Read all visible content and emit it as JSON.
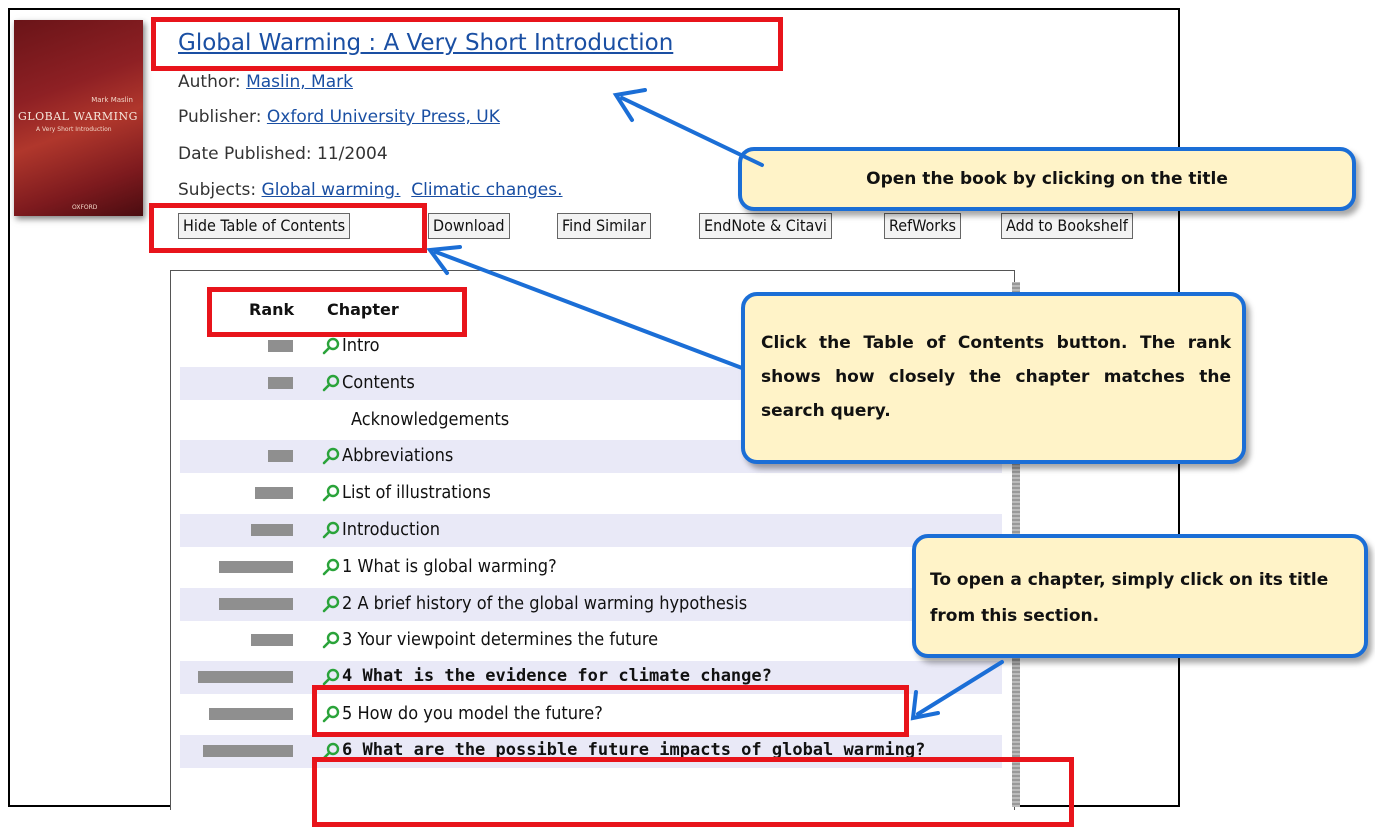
{
  "book": {
    "title": "Global Warming : A Very Short Introduction",
    "author_label": "Author:",
    "author": "Maslin, Mark",
    "publisher_label": "Publisher:",
    "publisher": "Oxford University Press, UK",
    "date_label": "Date Published:",
    "date": "11/2004",
    "subjects_label": "Subjects:",
    "subjects": [
      "Global warming.",
      "Climatic changes."
    ],
    "cover": {
      "title": "GLOBAL WARMING",
      "subtitle": "A Very Short Introduction",
      "author": "Mark Maslin",
      "publisher": "OXFORD"
    }
  },
  "buttons": [
    "Hide Table of Contents",
    "Download",
    "Find Similar",
    "EndNote & Citavi",
    "RefWorks",
    "Add to Bookshelf"
  ],
  "toc": {
    "rank_header": "Rank",
    "chapter_header": "Chapter",
    "rows": [
      {
        "label": "Intro",
        "rank": 0.26,
        "search_icon": true,
        "bold": false
      },
      {
        "label": "Contents",
        "rank": 0.26,
        "search_icon": true,
        "bold": false
      },
      {
        "label": "Acknowledgements",
        "rank": 0,
        "search_icon": false,
        "bold": false
      },
      {
        "label": "Abbreviations",
        "rank": 0.26,
        "search_icon": true,
        "bold": false
      },
      {
        "label": "List of illustrations",
        "rank": 0.4,
        "search_icon": true,
        "bold": false
      },
      {
        "label": "Introduction",
        "rank": 0.44,
        "search_icon": true,
        "bold": false
      },
      {
        "label": "1 What is global warming?",
        "rank": 0.78,
        "search_icon": true,
        "bold": false
      },
      {
        "label": "2 A brief history of the global warming hypothesis",
        "rank": 0.78,
        "search_icon": true,
        "bold": false
      },
      {
        "label": "3 Your viewpoint determines the future",
        "rank": 0.44,
        "search_icon": true,
        "bold": false
      },
      {
        "label": "4 What is the evidence for climate change?",
        "rank": 1.0,
        "search_icon": true,
        "bold": true
      },
      {
        "label": "5 How do you model the future?",
        "rank": 0.88,
        "search_icon": true,
        "bold": false
      },
      {
        "label": "6 What are the possible future impacts of global warming?",
        "rank": 0.95,
        "search_icon": true,
        "bold": true
      }
    ]
  },
  "callouts": {
    "open_book": "Open the book by clicking on the title",
    "toc_info": "Click the Table of Contents button. The rank shows how closely the chapter matches the search query.",
    "open_chapter": "To open a chapter, simply click on its title from this section."
  },
  "colors": {
    "highlight": "#e8141b",
    "arrow": "#1b6ed6",
    "callout_fill": "#fff3c8",
    "link": "#1a4fa3",
    "row_alt": "#e9e9f7",
    "rank_bar": "#8f8f8f",
    "search_icon": "#2aa33a"
  }
}
